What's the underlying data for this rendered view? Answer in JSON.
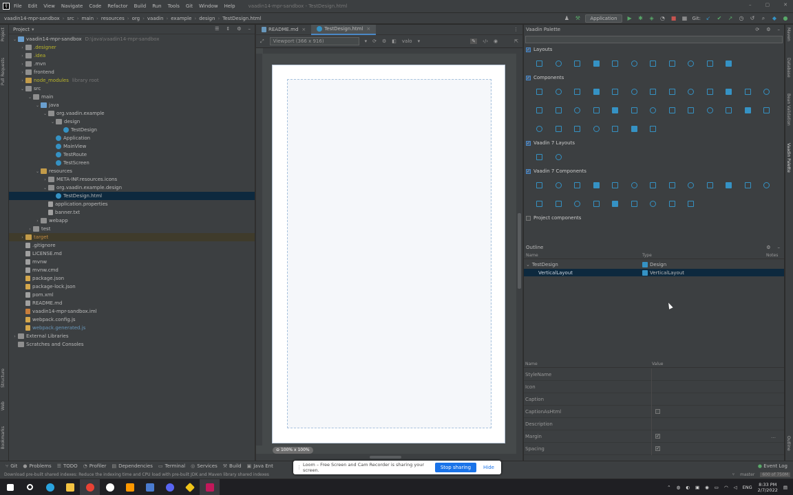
{
  "menubar": {
    "items": [
      "File",
      "Edit",
      "View",
      "Navigate",
      "Code",
      "Refactor",
      "Build",
      "Run",
      "Tools",
      "Git",
      "Window",
      "Help"
    ],
    "title": "vaadin14-mpr-sandbox - TestDesign.html"
  },
  "breadcrumb": [
    "vaadin14-mpr-sandbox",
    "src",
    "main",
    "resources",
    "org",
    "vaadin",
    "example",
    "design",
    "TestDesign.html"
  ],
  "toolbar": {
    "run_config": "Application",
    "git_label": "Git:"
  },
  "left_strip": [
    "Project",
    "Pull Requests",
    "Structure",
    "Web",
    "Bookmarks"
  ],
  "project": {
    "title": "Project",
    "tree": [
      {
        "indent": 0,
        "arrow": "▾",
        "icon": "fold blue",
        "text": "vaadin14-mpr-sandbox",
        "extra": "D:\\java\\vaadin14-mpr-sandbox",
        "cls": "t-normal"
      },
      {
        "indent": 1,
        "arrow": "›",
        "icon": "fold",
        "text": ".designer",
        "cls": "t-yellow"
      },
      {
        "indent": 1,
        "arrow": "›",
        "icon": "fold",
        "text": ".idea",
        "cls": "t-yellow"
      },
      {
        "indent": 1,
        "arrow": "›",
        "icon": "fold",
        "text": ".mvn",
        "cls": "t-normal"
      },
      {
        "indent": 1,
        "arrow": "›",
        "icon": "fold",
        "text": "frontend",
        "cls": "t-normal"
      },
      {
        "indent": 1,
        "arrow": "›",
        "icon": "fold orange",
        "text": "node_modules",
        "extra": "library root",
        "extra_full": "node_modules  library root",
        "cls": "t-yellow"
      },
      {
        "indent": 1,
        "arrow": "▾",
        "icon": "fold",
        "text": "src",
        "cls": "t-normal"
      },
      {
        "indent": 2,
        "arrow": "▾",
        "icon": "fold",
        "text": "main",
        "cls": "t-normal"
      },
      {
        "indent": 3,
        "arrow": "▾",
        "icon": "fold blue",
        "text": "java",
        "cls": "t-normal"
      },
      {
        "indent": 4,
        "arrow": "▾",
        "icon": "fold",
        "text": "org.vaadin.example",
        "cls": "t-normal"
      },
      {
        "indent": 5,
        "arrow": "▾",
        "icon": "fold",
        "text": "design",
        "cls": "t-normal"
      },
      {
        "indent": 6,
        "arrow": "",
        "icon": "file class",
        "text": "TestDesign",
        "cls": "t-normal"
      },
      {
        "indent": 5,
        "arrow": "",
        "icon": "file class",
        "text": "Application",
        "cls": "t-normal"
      },
      {
        "indent": 5,
        "arrow": "",
        "icon": "file class",
        "text": "MainView",
        "cls": "t-normal"
      },
      {
        "indent": 5,
        "arrow": "",
        "icon": "file class",
        "text": "TestRoute",
        "cls": "t-normal"
      },
      {
        "indent": 5,
        "arrow": "",
        "icon": "file class",
        "text": "TestScreen",
        "cls": "t-normal"
      },
      {
        "indent": 3,
        "arrow": "▾",
        "icon": "fold orange",
        "text": "resources",
        "cls": "t-normal"
      },
      {
        "indent": 4,
        "arrow": "›",
        "icon": "fold",
        "text": "META-INF.resources.icons",
        "cls": "t-normal"
      },
      {
        "indent": 4,
        "arrow": "▾",
        "icon": "fold",
        "text": "org.vaadin.example.design",
        "cls": "t-normal"
      },
      {
        "indent": 5,
        "arrow": "",
        "icon": "file class",
        "text": "TestDesign.html",
        "cls": "t-normal",
        "sel": true
      },
      {
        "indent": 4,
        "arrow": "",
        "icon": "file",
        "text": "application.properties",
        "cls": "t-normal"
      },
      {
        "indent": 4,
        "arrow": "",
        "icon": "file",
        "text": "banner.txt",
        "cls": "t-normal"
      },
      {
        "indent": 3,
        "arrow": "›",
        "icon": "fold",
        "text": "webapp",
        "cls": "t-normal"
      },
      {
        "indent": 2,
        "arrow": "›",
        "icon": "fold",
        "text": "test",
        "cls": "t-normal"
      },
      {
        "indent": 1,
        "arrow": "›",
        "icon": "fold orange",
        "text": "target",
        "cls": "t-orange",
        "hl": true
      },
      {
        "indent": 1,
        "arrow": "",
        "icon": "file",
        "text": ".gitignore",
        "cls": "t-normal"
      },
      {
        "indent": 1,
        "arrow": "",
        "icon": "file",
        "text": "LICENSE.md",
        "cls": "t-normal"
      },
      {
        "indent": 1,
        "arrow": "",
        "icon": "file",
        "text": "mvnw",
        "cls": "t-normal"
      },
      {
        "indent": 1,
        "arrow": "",
        "icon": "file",
        "text": "mvnw.cmd",
        "cls": "t-normal"
      },
      {
        "indent": 1,
        "arrow": "",
        "icon": "file js",
        "text": "package.json",
        "cls": "t-normal"
      },
      {
        "indent": 1,
        "arrow": "",
        "icon": "file js",
        "text": "package-lock.json",
        "cls": "t-normal"
      },
      {
        "indent": 1,
        "arrow": "",
        "icon": "file",
        "text": "pom.xml",
        "cls": "t-normal"
      },
      {
        "indent": 1,
        "arrow": "",
        "icon": "file",
        "text": "README.md",
        "cls": "t-normal"
      },
      {
        "indent": 1,
        "arrow": "",
        "icon": "file xml",
        "text": "vaadin14-mpr-sandbox.iml",
        "cls": "t-normal"
      },
      {
        "indent": 1,
        "arrow": "",
        "icon": "file js",
        "text": "webpack.config.js",
        "cls": "t-normal"
      },
      {
        "indent": 1,
        "arrow": "",
        "icon": "file js",
        "text": "webpack.generated.js",
        "cls": "t-blue"
      },
      {
        "indent": 0,
        "arrow": "›",
        "icon": "fold",
        "text": "External Libraries",
        "cls": "t-normal"
      },
      {
        "indent": 0,
        "arrow": "",
        "icon": "fold",
        "text": "Scratches and Consoles",
        "cls": "t-normal"
      }
    ]
  },
  "editor": {
    "tabs": [
      "README.md",
      "TestDesign.html"
    ],
    "viewport": "Viewport (366 x 916)",
    "theme": "valo",
    "zoom": "100% x 100%"
  },
  "palette": {
    "title": "Vaadin Palette",
    "groups": [
      {
        "label": "Layouts",
        "checked": true,
        "count": 11
      },
      {
        "label": "Components",
        "checked": true,
        "count": 33
      },
      {
        "label": "Vaadin 7 Layouts",
        "checked": true,
        "count": 2
      },
      {
        "label": "Vaadin 7 Components",
        "checked": true,
        "count": 22
      },
      {
        "label": "Project components",
        "checked": false,
        "count": 0
      }
    ]
  },
  "outline": {
    "title": "Outline",
    "cols": [
      "Name",
      "Type",
      "Notes"
    ],
    "rows": [
      {
        "name": "TestDesign",
        "type": "Design",
        "indent": 0,
        "sel": false
      },
      {
        "name": "VerticalLayout",
        "type": "VerticalLayout",
        "indent": 1,
        "sel": true
      }
    ]
  },
  "properties": {
    "cols": [
      "Name",
      "Value"
    ],
    "rows": [
      {
        "name": "StyleName",
        "value": ""
      },
      {
        "name": "Icon",
        "value": ""
      },
      {
        "name": "Caption",
        "value": ""
      },
      {
        "name": "CaptionAsHtml",
        "value": "checkbox-off"
      },
      {
        "name": "Description",
        "value": ""
      },
      {
        "name": "Margin",
        "value": "checkbox-on"
      },
      {
        "name": "Spacing",
        "value": "checkbox-on"
      }
    ]
  },
  "right_strip": [
    "Maven",
    "Database",
    "Bean Validation",
    "Vaadin Palette",
    "Outline"
  ],
  "bottom_tools": [
    "Git",
    "Problems",
    "TODO",
    "Profiler",
    "Dependencies",
    "Terminal",
    "Services",
    "Build",
    "Java Ent"
  ],
  "event_log": "Event Log",
  "status": {
    "message": "Download pre-built shared indexes: Reduce the indexing time and CPU load with pre-built JDK and Maven library shared indexes",
    "branch": "master",
    "memory": "600 of 750M"
  },
  "loom": {
    "message": "Loom – Free Screen and Cam Recorder is sharing your screen.",
    "stop": "Stop sharing",
    "hide": "Hide"
  },
  "taskbar": {
    "lang": "ENG",
    "time": "8:33 PM",
    "date": "2/7/2022"
  }
}
